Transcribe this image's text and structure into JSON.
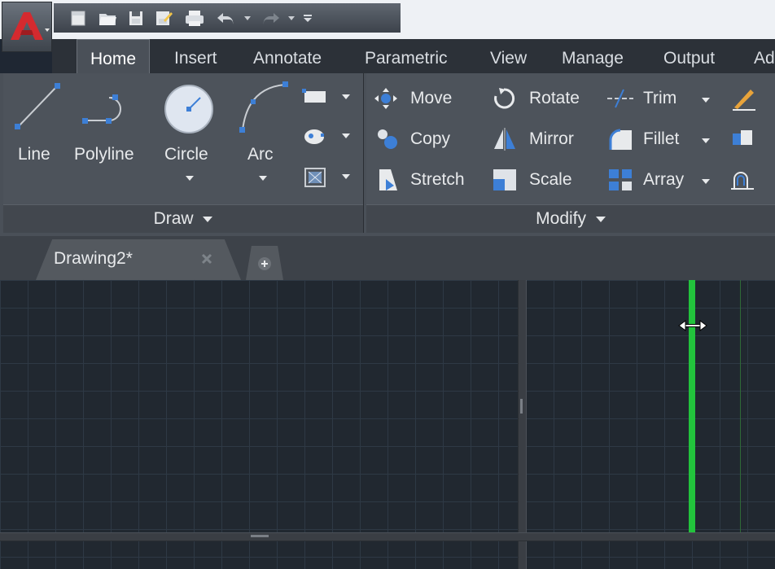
{
  "quick_access": {
    "icons": [
      "new-icon",
      "open-icon",
      "save-icon",
      "save-as-icon",
      "plot-icon",
      "undo-icon",
      "dropdown-icon",
      "redo-icon",
      "dropdown-icon",
      "customize-icon"
    ]
  },
  "ribbon_tabs": [
    "Home",
    "Insert",
    "Annotate",
    "Parametric",
    "View",
    "Manage",
    "Output",
    "Ad"
  ],
  "draw_panel": {
    "tools": [
      "Line",
      "Polyline",
      "Circle",
      "Arc"
    ],
    "footer": "Draw"
  },
  "modify_panel": {
    "tools": [
      [
        "Move",
        "Rotate",
        "Trim"
      ],
      [
        "Copy",
        "Mirror",
        "Fillet"
      ],
      [
        "Stretch",
        "Scale",
        "Array"
      ]
    ],
    "footer": "Modify"
  },
  "doc_tab": {
    "name": "Drawing2*"
  },
  "colors": {
    "accent_green": "#22c33c",
    "app_red": "#c8262c"
  }
}
